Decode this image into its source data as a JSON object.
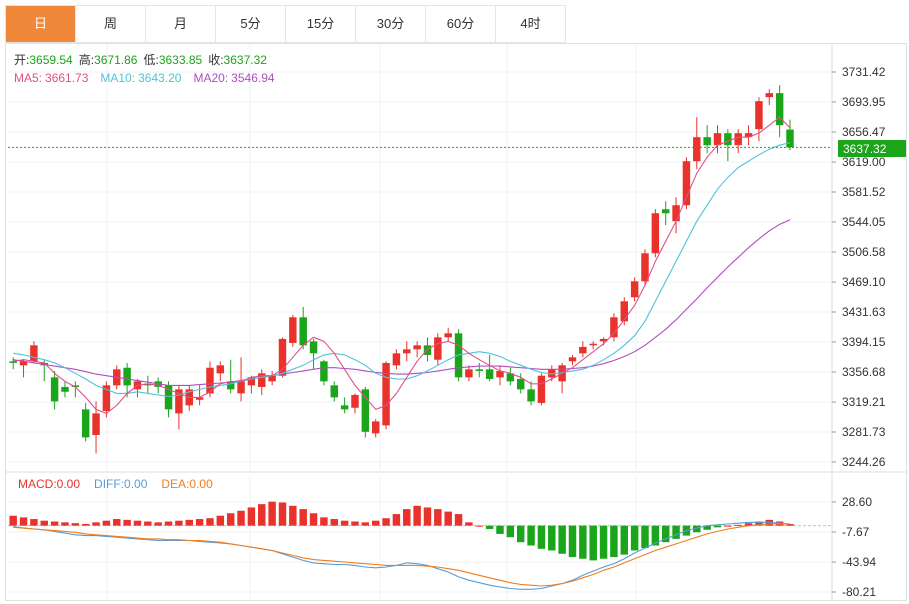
{
  "tabs": [
    {
      "label": "日",
      "active": true
    },
    {
      "label": "周",
      "active": false
    },
    {
      "label": "月",
      "active": false
    },
    {
      "label": "5分",
      "active": false
    },
    {
      "label": "15分",
      "active": false
    },
    {
      "label": "30分",
      "active": false
    },
    {
      "label": "60分",
      "active": false
    },
    {
      "label": "4时",
      "active": false
    }
  ],
  "ohlc_legend": {
    "open_label": "开:",
    "open": "3659.54",
    "high_label": "高:",
    "high": "3671.86",
    "low_label": "低:",
    "low": "3633.85",
    "close_label": "收:",
    "close": "3637.32"
  },
  "ma_legend": {
    "ma5_label": "MA5:",
    "ma5": "3661.73",
    "ma10_label": "MA10:",
    "ma10": "3643.20",
    "ma20_label": "MA20:",
    "ma20": "3546.94"
  },
  "macd_legend": {
    "macd_label": "MACD:",
    "macd": "0.00",
    "diff_label": "DIFF:",
    "diff": "0.00",
    "dea_label": "DEA:",
    "dea": "0.00"
  },
  "last_price_tag": "3637.32",
  "colors": {
    "up": "#e8322b",
    "down": "#1aa51a",
    "ma5": "#e0508a",
    "ma10": "#4ec3d8",
    "ma20": "#b04ec0",
    "diff": "#5b9bd5",
    "dea": "#f07d1e",
    "accent": "#f0883c"
  },
  "chart_data": {
    "type": "candlestick",
    "price_axis_ticks": [
      "3731.42",
      "3693.95",
      "3656.47",
      "3619.00",
      "3581.52",
      "3544.05",
      "3506.58",
      "3469.10",
      "3431.63",
      "3394.15",
      "3356.68",
      "3319.21",
      "3281.73",
      "3244.26"
    ],
    "macd_axis_ticks": [
      "28.60",
      "-7.67",
      "-43.94",
      "-80.21"
    ],
    "ylim": [
      3244.26,
      3731.42
    ],
    "macd_ylim": [
      -80.21,
      28.6
    ],
    "candles": [
      [
        3370,
        3375,
        3360,
        3368
      ],
      [
        3365,
        3373,
        3350,
        3370
      ],
      [
        3370,
        3395,
        3368,
        3390
      ],
      [
        3368,
        3372,
        3345,
        3365
      ],
      [
        3350,
        3358,
        3310,
        3320
      ],
      [
        3338,
        3345,
        3325,
        3332
      ],
      [
        3340,
        3345,
        3325,
        3338
      ],
      [
        3310,
        3318,
        3270,
        3275
      ],
      [
        3278,
        3320,
        3255,
        3305
      ],
      [
        3308,
        3345,
        3300,
        3340
      ],
      [
        3340,
        3365,
        3335,
        3360
      ],
      [
        3362,
        3368,
        3325,
        3340
      ],
      [
        3335,
        3348,
        3325,
        3345
      ],
      [
        3342,
        3352,
        3330,
        3340
      ],
      [
        3345,
        3350,
        3330,
        3338
      ],
      [
        3340,
        3345,
        3300,
        3310
      ],
      [
        3305,
        3340,
        3285,
        3335
      ],
      [
        3315,
        3340,
        3308,
        3335
      ],
      [
        3322,
        3340,
        3315,
        3325
      ],
      [
        3330,
        3370,
        3325,
        3362
      ],
      [
        3355,
        3370,
        3345,
        3365
      ],
      [
        3345,
        3372,
        3330,
        3335
      ],
      [
        3330,
        3375,
        3320,
        3345
      ],
      [
        3340,
        3352,
        3330,
        3350
      ],
      [
        3338,
        3360,
        3328,
        3355
      ],
      [
        3345,
        3358,
        3340,
        3352
      ],
      [
        3352,
        3400,
        3350,
        3398
      ],
      [
        3393,
        3428,
        3388,
        3425
      ],
      [
        3425,
        3438,
        3385,
        3390
      ],
      [
        3395,
        3398,
        3360,
        3380
      ],
      [
        3370,
        3372,
        3340,
        3345
      ],
      [
        3340,
        3345,
        3320,
        3325
      ],
      [
        3315,
        3325,
        3305,
        3310
      ],
      [
        3312,
        3330,
        3305,
        3328
      ],
      [
        3335,
        3338,
        3275,
        3282
      ],
      [
        3280,
        3298,
        3275,
        3295
      ],
      [
        3290,
        3370,
        3285,
        3368
      ],
      [
        3365,
        3385,
        3360,
        3380
      ],
      [
        3380,
        3395,
        3370,
        3385
      ],
      [
        3385,
        3395,
        3375,
        3390
      ],
      [
        3390,
        3400,
        3370,
        3378
      ],
      [
        3372,
        3405,
        3365,
        3400
      ],
      [
        3400,
        3412,
        3395,
        3405
      ],
      [
        3405,
        3410,
        3345,
        3350
      ],
      [
        3350,
        3365,
        3345,
        3360
      ],
      [
        3360,
        3368,
        3350,
        3358
      ],
      [
        3360,
        3378,
        3345,
        3348
      ],
      [
        3350,
        3365,
        3340,
        3358
      ],
      [
        3355,
        3362,
        3340,
        3345
      ],
      [
        3348,
        3355,
        3330,
        3335
      ],
      [
        3335,
        3345,
        3315,
        3320
      ],
      [
        3318,
        3355,
        3315,
        3352
      ],
      [
        3350,
        3365,
        3345,
        3360
      ],
      [
        3345,
        3368,
        3330,
        3365
      ],
      [
        3370,
        3378,
        3365,
        3375
      ],
      [
        3380,
        3395,
        3375,
        3388
      ],
      [
        3390,
        3395,
        3385,
        3392
      ],
      [
        3395,
        3400,
        3390,
        3398
      ],
      [
        3400,
        3430,
        3395,
        3425
      ],
      [
        3420,
        3450,
        3415,
        3445
      ],
      [
        3450,
        3475,
        3445,
        3470
      ],
      [
        3470,
        3510,
        3465,
        3505
      ],
      [
        3505,
        3560,
        3500,
        3555
      ],
      [
        3560,
        3570,
        3540,
        3555
      ],
      [
        3545,
        3575,
        3530,
        3565
      ],
      [
        3565,
        3625,
        3560,
        3620
      ],
      [
        3620,
        3675,
        3610,
        3650
      ],
      [
        3650,
        3665,
        3630,
        3640
      ],
      [
        3640,
        3665,
        3630,
        3655
      ],
      [
        3655,
        3660,
        3620,
        3640
      ],
      [
        3640,
        3660,
        3630,
        3655
      ],
      [
        3650,
        3665,
        3640,
        3655
      ],
      [
        3660,
        3700,
        3645,
        3695
      ],
      [
        3700,
        3710,
        3690,
        3705
      ],
      [
        3705,
        3715,
        3650,
        3665
      ],
      [
        3659.54,
        3671.86,
        3633.85,
        3637.32
      ]
    ],
    "ma5": [
      3370,
      3372,
      3370,
      3368,
      3355,
      3345,
      3338,
      3325,
      3310,
      3305,
      3315,
      3330,
      3340,
      3342,
      3340,
      3335,
      3330,
      3325,
      3325,
      3332,
      3342,
      3345,
      3345,
      3350,
      3352,
      3352,
      3360,
      3375,
      3390,
      3400,
      3395,
      3380,
      3360,
      3340,
      3325,
      3310,
      3315,
      3330,
      3350,
      3370,
      3385,
      3392,
      3395,
      3390,
      3380,
      3372,
      3365,
      3358,
      3355,
      3350,
      3342,
      3342,
      3348,
      3355,
      3362,
      3372,
      3382,
      3392,
      3405,
      3422,
      3440,
      3465,
      3495,
      3520,
      3545,
      3575,
      3605,
      3625,
      3640,
      3645,
      3650,
      3650,
      3655,
      3665,
      3675,
      3661.73
    ],
    "ma10": [
      3380,
      3378,
      3375,
      3372,
      3368,
      3362,
      3355,
      3348,
      3340,
      3335,
      3330,
      3330,
      3332,
      3330,
      3328,
      3326,
      3328,
      3332,
      3335,
      3338,
      3340,
      3342,
      3345,
      3348,
      3350,
      3352,
      3355,
      3360,
      3365,
      3372,
      3378,
      3380,
      3378,
      3372,
      3365,
      3355,
      3350,
      3348,
      3348,
      3352,
      3358,
      3365,
      3372,
      3378,
      3380,
      3382,
      3380,
      3376,
      3370,
      3365,
      3360,
      3356,
      3354,
      3356,
      3358,
      3360,
      3365,
      3372,
      3380,
      3390,
      3402,
      3420,
      3445,
      3470,
      3495,
      3520,
      3545,
      3565,
      3585,
      3600,
      3612,
      3620,
      3628,
      3635,
      3640,
      3643.2
    ],
    "ma20": [
      3372,
      3370,
      3368,
      3366,
      3364,
      3362,
      3360,
      3357,
      3354,
      3352,
      3350,
      3348,
      3346,
      3344,
      3342,
      3340,
      3340,
      3340,
      3341,
      3342,
      3343,
      3344,
      3346,
      3348,
      3350,
      3352,
      3354,
      3356,
      3358,
      3360,
      3362,
      3362,
      3361,
      3360,
      3358,
      3356,
      3355,
      3354,
      3354,
      3355,
      3356,
      3358,
      3360,
      3362,
      3363,
      3364,
      3364,
      3364,
      3363,
      3362,
      3361,
      3360,
      3360,
      3360,
      3361,
      3362,
      3364,
      3367,
      3371,
      3376,
      3382,
      3390,
      3400,
      3410,
      3422,
      3435,
      3448,
      3462,
      3475,
      3488,
      3500,
      3512,
      3523,
      3533,
      3541,
      3546.94
    ],
    "macd_bars": [
      12,
      10,
      8,
      6,
      5,
      4,
      3,
      2,
      4,
      6,
      8,
      7,
      6,
      5,
      4,
      5,
      6,
      7,
      8,
      9,
      12,
      15,
      18,
      22,
      26,
      29,
      28,
      24,
      20,
      15,
      10,
      8,
      6,
      5,
      4,
      6,
      9,
      14,
      20,
      24,
      22,
      20,
      17,
      14,
      4,
      0,
      -4,
      -10,
      -14,
      -20,
      -24,
      -28,
      -30,
      -34,
      -38,
      -40,
      -42,
      -40,
      -38,
      -35,
      -30,
      -27,
      -24,
      -20,
      -16,
      -12,
      -8,
      -5,
      -2,
      0,
      1,
      3,
      5,
      7,
      5,
      2
    ],
    "diff": [
      -1,
      -3,
      -4,
      -5,
      -7,
      -9,
      -11,
      -12,
      -12,
      -13,
      -14,
      -15,
      -16,
      -17,
      -18,
      -18,
      -18,
      -18,
      -19,
      -20,
      -21,
      -22,
      -24,
      -26,
      -28,
      -30,
      -34,
      -38,
      -42,
      -45,
      -46,
      -47,
      -47,
      -48,
      -50,
      -51,
      -50,
      -48,
      -45,
      -46,
      -48,
      -52,
      -56,
      -62,
      -66,
      -69,
      -72,
      -74,
      -76,
      -77,
      -77,
      -76,
      -73,
      -70,
      -66,
      -60,
      -55,
      -50,
      -46,
      -40,
      -33,
      -27,
      -21,
      -16,
      -11,
      -6,
      -3,
      0,
      1,
      2,
      3,
      4,
      4,
      4,
      3,
      2
    ],
    "dea": [
      -2,
      -3,
      -4,
      -5,
      -6,
      -7,
      -8,
      -10,
      -11,
      -12,
      -13,
      -14,
      -15,
      -16,
      -16,
      -17,
      -17,
      -18,
      -18,
      -19,
      -20,
      -22,
      -24,
      -26,
      -28,
      -30,
      -33,
      -36,
      -39,
      -41,
      -42,
      -43,
      -44,
      -45,
      -46,
      -47,
      -48,
      -48,
      -48,
      -48,
      -49,
      -50,
      -52,
      -54,
      -57,
      -60,
      -63,
      -66,
      -69,
      -71,
      -72,
      -73,
      -72,
      -70,
      -67,
      -63,
      -59,
      -54,
      -50,
      -45,
      -40,
      -35,
      -30,
      -26,
      -22,
      -18,
      -14,
      -10,
      -7,
      -4,
      -2,
      0,
      1,
      2,
      2,
      2
    ]
  }
}
